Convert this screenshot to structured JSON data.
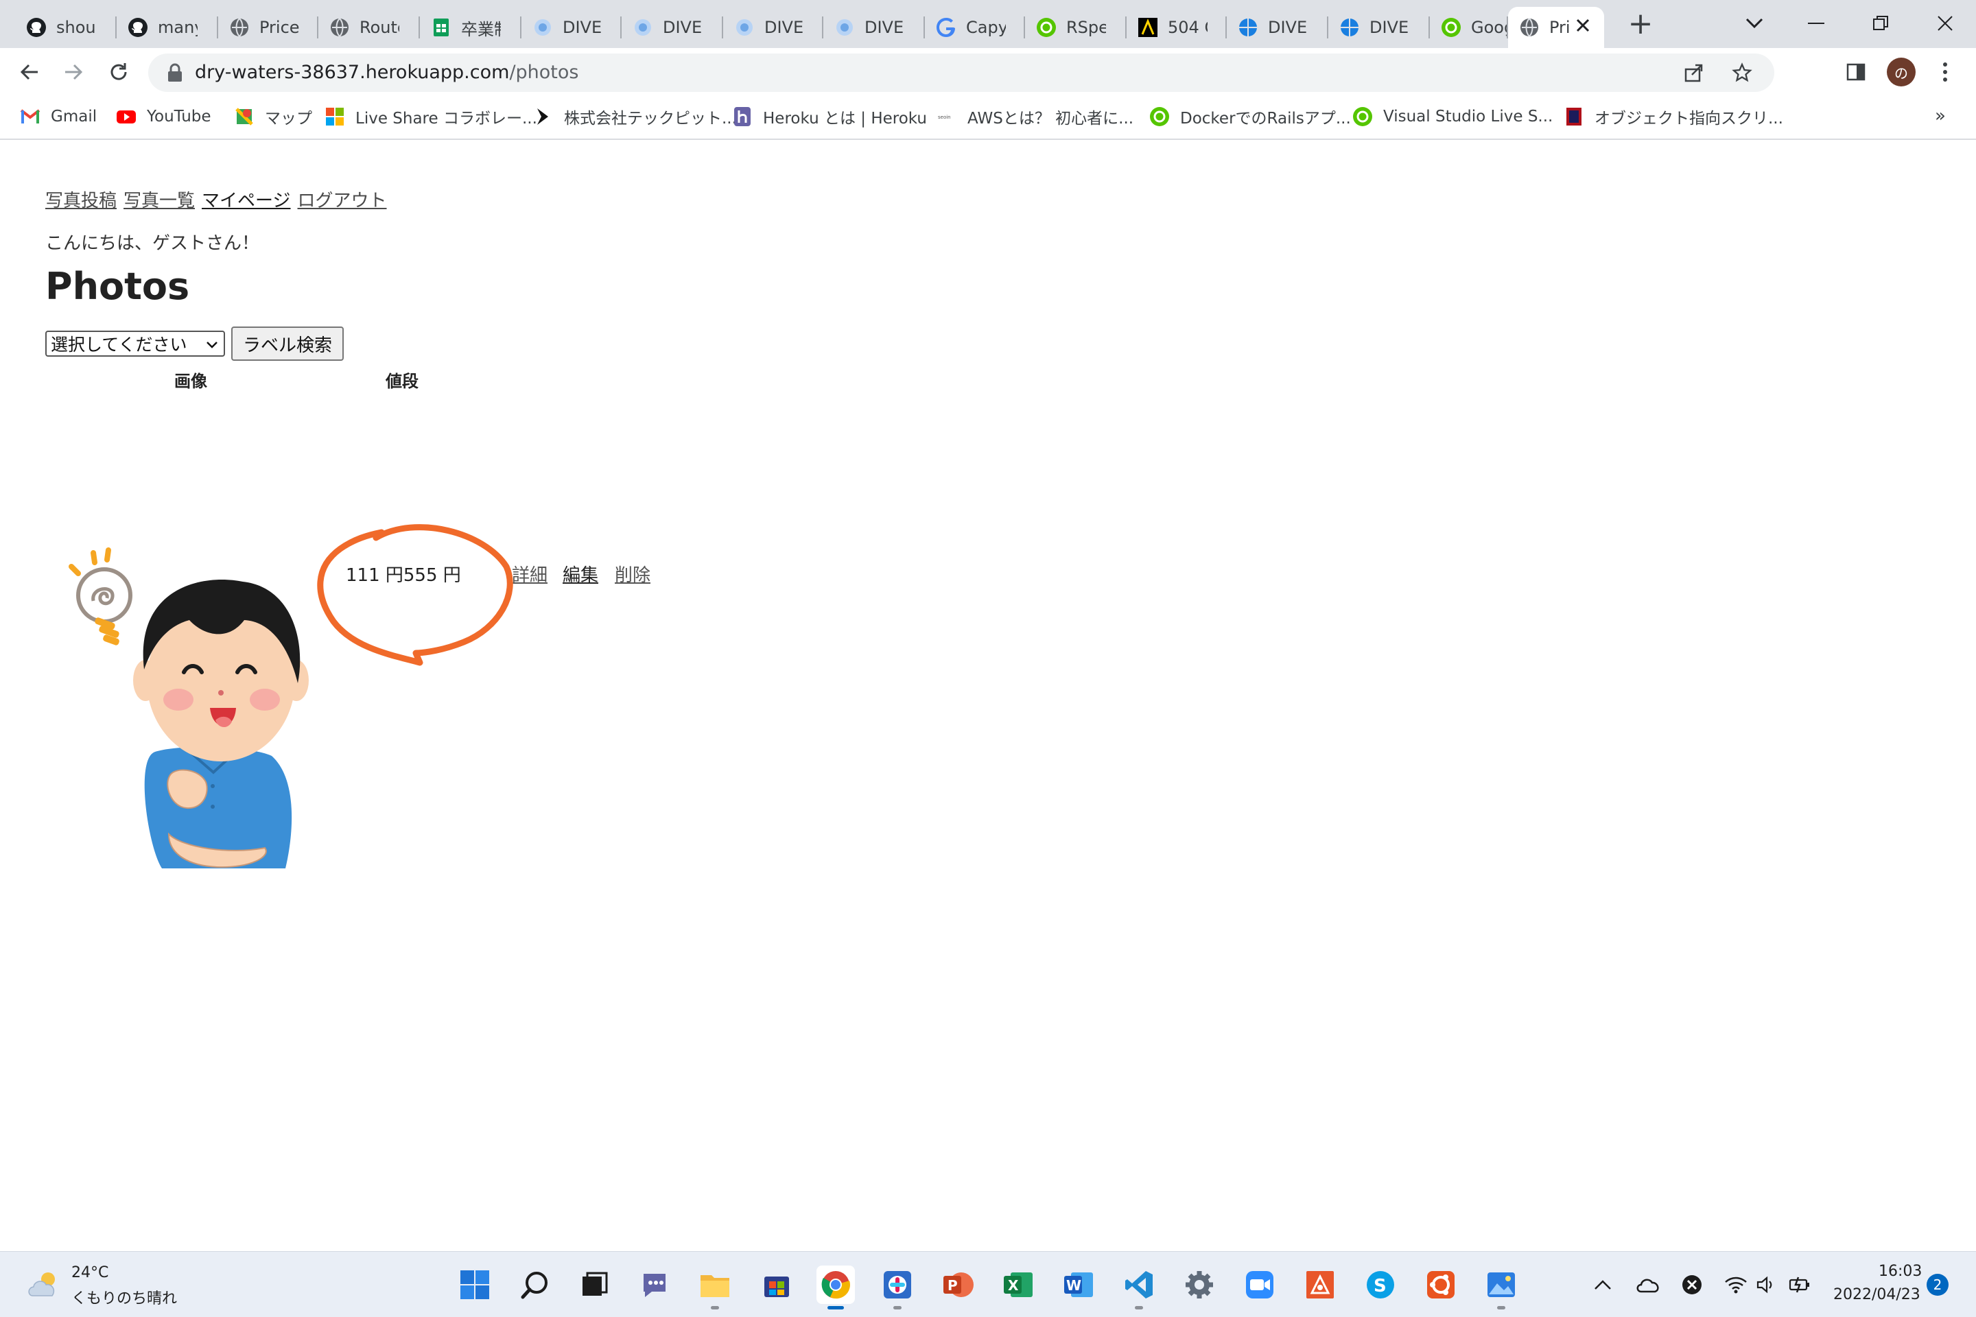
{
  "browser": {
    "tabs": [
      {
        "label": "shouh",
        "icon": "github-icon"
      },
      {
        "label": "manyc",
        "icon": "github-icon"
      },
      {
        "label": "PriceN",
        "icon": "globe-icon"
      },
      {
        "label": "Route",
        "icon": "globe-icon"
      },
      {
        "label": "卒業制",
        "icon": "sheets-icon"
      },
      {
        "label": "DIVER",
        "icon": "diver-icon"
      },
      {
        "label": "DIVER",
        "icon": "diver-icon"
      },
      {
        "label": "DIVER",
        "icon": "diver-icon"
      },
      {
        "label": "DIVER",
        "icon": "diver-icon"
      },
      {
        "label": "Capyb",
        "icon": "google-icon"
      },
      {
        "label": "RSpec",
        "icon": "qiita-icon"
      },
      {
        "label": "504 G",
        "icon": "lambda-icon"
      },
      {
        "label": "DIVE I",
        "icon": "diver-globe-icon"
      },
      {
        "label": "DIVE I",
        "icon": "diver-globe-icon"
      },
      {
        "label": "Googl",
        "icon": "qiita-icon"
      },
      {
        "label": "Pri",
        "icon": "globe-icon",
        "active": true
      }
    ],
    "url": {
      "host": "dry-waters-38637.herokuapp.com",
      "path": "/photos"
    },
    "profile_initial": "の",
    "bookmarks": [
      {
        "label": "Gmail",
        "icon": "gmail-icon"
      },
      {
        "label": "YouTube",
        "icon": "youtube-icon"
      },
      {
        "label": "マップ",
        "icon": "maps-icon"
      },
      {
        "label": "Live Share コラボレー...",
        "icon": "microsoft-icon"
      },
      {
        "label": "株式会社テックピット...",
        "icon": "techpit-icon"
      },
      {
        "label": "Heroku とは | Heroku",
        "icon": "heroku-icon"
      },
      {
        "label": "AWSとは？ 初心者に...",
        "icon": "aws-icon"
      },
      {
        "label": "DockerでのRailsアプ...",
        "icon": "qiita-icon"
      },
      {
        "label": "Visual Studio Live S...",
        "icon": "qiita-icon"
      },
      {
        "label": "オブジェクト指向スクリ...",
        "icon": "book-icon"
      }
    ],
    "more_bookmarks": "»"
  },
  "page": {
    "nav": {
      "post": "写真投稿",
      "list": "写真一覧",
      "mypage": "マイページ",
      "logout": "ログアウト"
    },
    "greeting": "こんにちは、ゲストさん！",
    "title": "Photos",
    "label_select": {
      "selected": "選択してください"
    },
    "label_search_button": "ラベル検索",
    "table": {
      "headers": {
        "image": "画像",
        "price": "値段"
      },
      "rows": [
        {
          "price": "111 円555 円",
          "show": "詳細",
          "edit": "編集",
          "delete": "削除"
        }
      ]
    },
    "annotation_color": "#f06a2a"
  },
  "taskbar": {
    "weather_temp": "24°C",
    "weather_desc": "くもりのち晴れ",
    "apps": [
      "windows-start-icon",
      "search-icon",
      "task-view-icon",
      "teams-chat-icon",
      "file-explorer-icon",
      "ms-store-icon",
      "chrome-icon",
      "slack-icon",
      "powerpoint-icon",
      "excel-icon",
      "word-icon",
      "vscode-icon",
      "settings-icon",
      "zoom-icon",
      "app-orange-icon",
      "skype-icon",
      "ubuntu-icon",
      "photos-icon"
    ],
    "clock_time": "16:03",
    "clock_date": "2022/04/23",
    "notifications": "2"
  }
}
